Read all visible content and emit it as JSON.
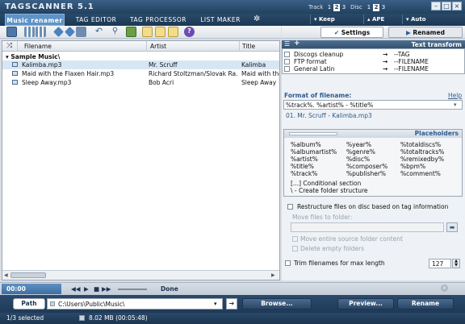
{
  "app": {
    "title": "TAGSCANNER 5.1"
  },
  "title_controls": {
    "track_label": "Track",
    "track_digits": [
      "1",
      "2",
      "3"
    ],
    "disc_label": "Disc",
    "disc_digits": [
      "1",
      "2",
      "3"
    ]
  },
  "tabs": [
    "Music renamer",
    "TAG EDITOR",
    "TAG PROCESSOR",
    "LIST MAKER"
  ],
  "dropdowns": [
    {
      "label": "▾ Keep"
    },
    {
      "label": "▴ APE"
    },
    {
      "label": "▾ Auto"
    }
  ],
  "right_tabs": {
    "settings": "Settings",
    "renamed": "Renamed"
  },
  "columns": [
    "Filename",
    "Artist",
    "Title"
  ],
  "group": {
    "label": "Sample Music\\"
  },
  "rows": [
    {
      "filename": "Kalimba.mp3",
      "artist": "Mr. Scruff",
      "title": "Kalimba",
      "selected": true
    },
    {
      "filename": "Maid with the Flaxen Hair.mp3",
      "artist": "Richard Stoltzman/Slovak Ra...",
      "title": "Maid with the",
      "selected": false
    },
    {
      "filename": "Sleep Away.mp3",
      "artist": "Bob Acri",
      "title": "Sleep Away",
      "selected": false
    }
  ],
  "text_transform": {
    "header": "Text transform",
    "items": [
      {
        "name": "Discogs cleanup",
        "arrow": "→",
        "target": "--TAG"
      },
      {
        "name": "FTP format",
        "arrow": "→",
        "target": "--FILENAME"
      },
      {
        "name": "General Latin",
        "arrow": "→",
        "target": "--FILENAME"
      }
    ]
  },
  "format": {
    "label": "Format of filename:",
    "help": "Help",
    "value": "%track%. %artist% - %title%",
    "preview": "01. Mr. Scruff - Kalimba.mp3"
  },
  "placeholders": {
    "header": "Placeholders",
    "col1": [
      "%album%",
      "%albumartist%",
      "%artist%",
      "%title%",
      "%track%"
    ],
    "col2": [
      "%year%",
      "%genre%",
      "%disc%",
      "%composer%",
      "%publisher%"
    ],
    "col3": [
      "%totaldiscs%",
      "%totaltracks%",
      "%remixedby%",
      "%bpm%",
      "%comment%"
    ],
    "notes": [
      "[...] Conditional section",
      "\\ - Create folder structure"
    ]
  },
  "restructure": {
    "label": "Restructure files on disc based on tag information",
    "move_label": "Move files to folder:",
    "move_content": "Move entire source folder content",
    "delete_empty": "Delete empty folders"
  },
  "trim": {
    "label": "Trim filenames for max length",
    "value": "127"
  },
  "player": {
    "time": "00:00",
    "status": "Done",
    "controls": [
      "◀◀",
      "▶",
      "■",
      "▶▶"
    ]
  },
  "path": {
    "label": "Path",
    "value": "C:\\Users\\Public\\Music\\"
  },
  "buttons": {
    "browse": "Browse...",
    "preview": "Preview...",
    "rename": "Rename"
  },
  "status": {
    "selected": "1/3 selected",
    "size": "8.02 MB (00:05:48)"
  },
  "colors": {
    "accent": "#5f93c6",
    "dark": "#1f3a57",
    "selection": "#d7e6f5"
  }
}
